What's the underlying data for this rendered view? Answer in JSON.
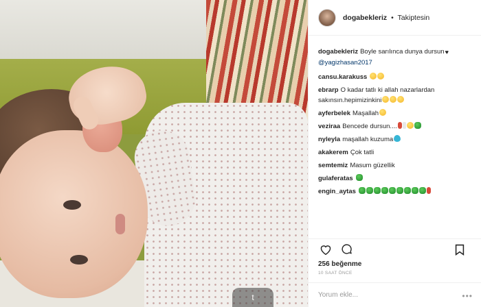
{
  "header": {
    "username": "dogabekleriz",
    "separator": "•",
    "follow_status": "Takiptesin"
  },
  "photo": {
    "watermark": "t"
  },
  "caption": {
    "user": "dogabekleriz",
    "text": "Boyle sarılınca dunya dursun",
    "mention": "@yagizhasan2017"
  },
  "comments": [
    {
      "user": "cansu.karakuss",
      "text": "",
      "emojis": [
        "y",
        "y"
      ]
    },
    {
      "user": "ebrarp",
      "text": "O kadar tatlı ki allah nazarlardan sakınsın.hepimizinkini",
      "emojis": [
        "y",
        "y",
        "y"
      ]
    },
    {
      "user": "ayferbelek",
      "text": "Maşallah",
      "emojis": [
        "y"
      ]
    },
    {
      "user": "veziraa",
      "text": "Bencede dursun....",
      "emojis": [
        "r",
        "w",
        "y",
        "g"
      ]
    },
    {
      "user": "nyleyla",
      "text": "maşallah kuzuma",
      "emojis": [
        "b"
      ]
    },
    {
      "user": "akakerem",
      "text": "Çok tatli",
      "emojis": []
    },
    {
      "user": "semtemiz",
      "text": "Masum güzellik",
      "emojis": []
    },
    {
      "user": "gulaferatas",
      "text": "",
      "emojis": [
        "g"
      ]
    },
    {
      "user": "engin_aytas",
      "text": "",
      "emojis": [
        "g",
        "g",
        "g",
        "g",
        "g",
        "g",
        "g",
        "g",
        "g",
        "r"
      ]
    }
  ],
  "actions": {
    "like_icon": "heart-icon",
    "comment_icon": "comment-icon",
    "save_icon": "bookmark-icon"
  },
  "likes": "256 beğenme",
  "timestamp": "10 SAAT ÖNCE",
  "comment_input": {
    "placeholder": "Yorum ekle..."
  },
  "more": "•••"
}
